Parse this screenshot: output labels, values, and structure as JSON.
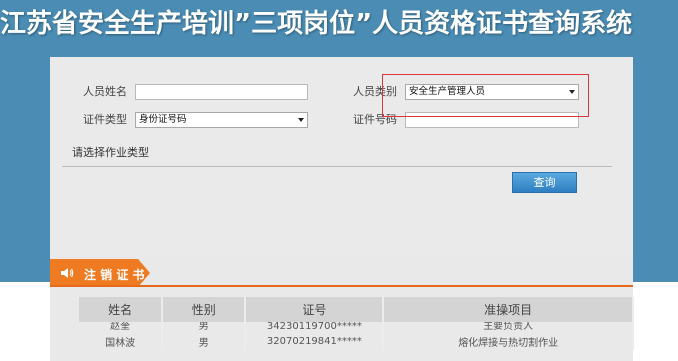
{
  "site_title": "江苏省安全生产培训”三项岗位”人员资格证书查询系统",
  "form": {
    "name_label": "人员姓名",
    "name_value": "",
    "person_type_label": "人员类别",
    "person_type_selected": "安全生产管理人员",
    "id_type_label": "证件类型",
    "id_type_selected": "身份证号码",
    "id_number_label": "证件号码",
    "id_number_value": "",
    "work_type_heading": "请选择作业类型",
    "query_button": "查询"
  },
  "cancel_tab": {
    "label": "注 销 证 书",
    "icon": "speaker-icon"
  },
  "table": {
    "headers": [
      "姓名",
      "性别",
      "证号",
      "准操项目"
    ],
    "rows": [
      [
        "赵奎",
        "男",
        "34230119700*****",
        "主要负责人"
      ],
      [
        "国林波",
        "男",
        "32070219841*****",
        "熔化焊接与热切割作业"
      ]
    ]
  },
  "colors": {
    "header_blue": "#4a8cb4",
    "accent_orange": "#ee7a22",
    "highlight_red": "#d9373c",
    "button_blue": "#2f7fc2"
  }
}
